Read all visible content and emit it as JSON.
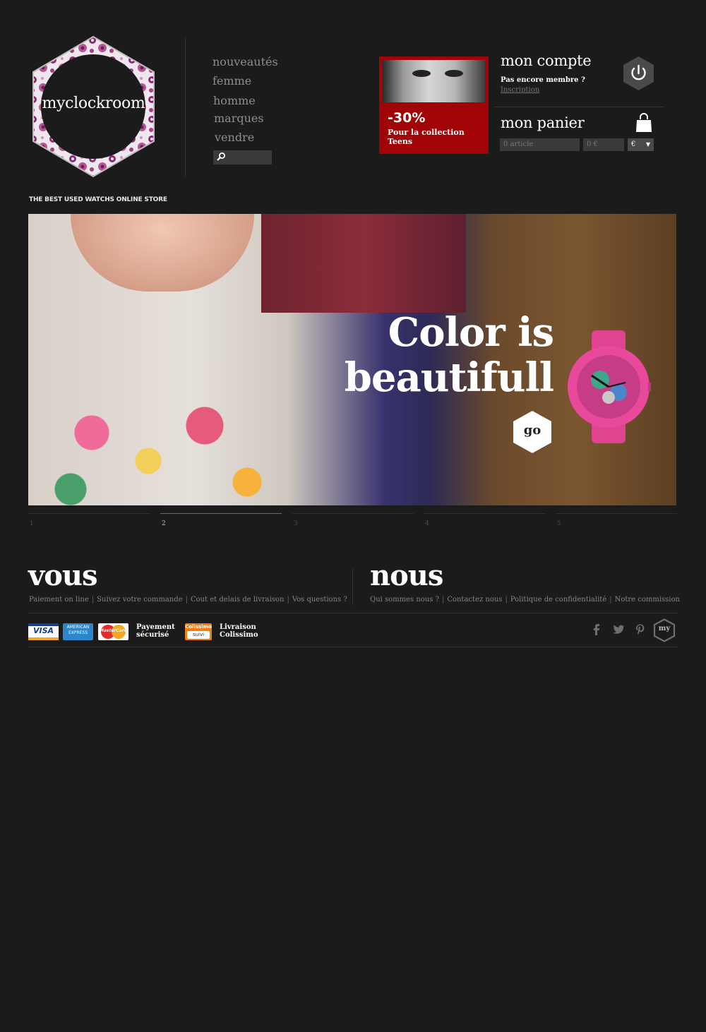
{
  "header": {
    "logo_text": "myclockroom",
    "tagline": "THE BEST USED WATCHS ONLINE STORE",
    "nav": [
      "nouveautés",
      "femme",
      "homme",
      "marques",
      "vendre"
    ],
    "search_placeholder": ""
  },
  "promo": {
    "discount": "-30%",
    "line1": "Pour la collection",
    "line2": "Teens"
  },
  "account": {
    "title": "mon compte",
    "not_member": "Pas encore membre ?",
    "signup": "Inscription"
  },
  "cart": {
    "title": "mon panier",
    "articles": "0 article",
    "total": "0 €",
    "currency": "€"
  },
  "hero": {
    "title_line1": "Color is",
    "title_line2": "beautifull",
    "go_label": "go"
  },
  "pager": {
    "pages": [
      "1",
      "2",
      "3",
      "4",
      "5"
    ],
    "active": 2
  },
  "footer": {
    "vous": {
      "title": "vous",
      "links": [
        "Paiement on line",
        "Suivez votre commande",
        "Cout et delais de livraison",
        "Vos questions ?"
      ]
    },
    "nous": {
      "title": "nous",
      "links": [
        "Qui sommes nous ?",
        "Contactez nous",
        "Politique de confidentialité",
        "Notre commission"
      ]
    },
    "payment_cards": [
      "VISA",
      "AMERICAN EXPRESS",
      "MasterCard"
    ],
    "payment_label_1": "Payement",
    "payment_label_2": "sécurisé",
    "colissimo_badge_top": "Colissimo",
    "colissimo_badge_bottom": "suivi",
    "delivery_label_1": "Livraison",
    "delivery_label_2": "Colissimo",
    "social": [
      "facebook-icon",
      "twitter-icon",
      "pinterest-icon",
      "my-icon"
    ],
    "my_badge": "my"
  },
  "colors": {
    "background": "#1b1b1c",
    "promo_red": "#a00406",
    "nav_text": "#8e8e8e",
    "field_bg": "#3a3a3a"
  }
}
